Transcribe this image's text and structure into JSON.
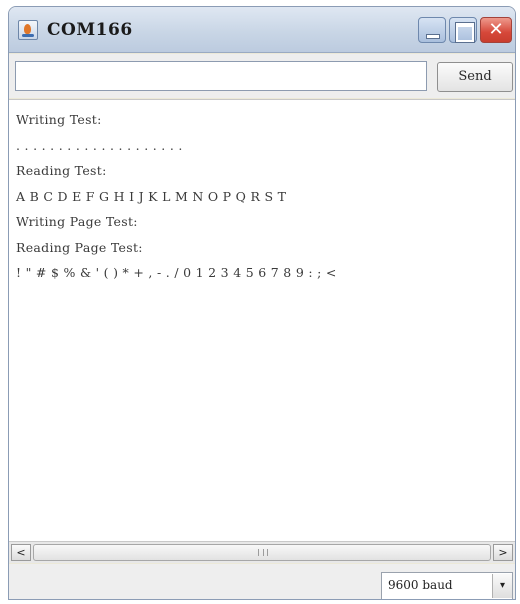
{
  "window": {
    "title": "COM166"
  },
  "toolbar": {
    "input_value": "",
    "send_label": "Send"
  },
  "output": {
    "lines": [
      "Writing Test:",
      ". . . . . . . . . . . . . . . . . . . .",
      "Reading Test:",
      "A B C D E F G H I J K L M N O P Q R S T",
      "Writing Page Test:",
      "Reading Page Test:",
      "! \" # $ % & ' ( ) * + , - . / 0 1 2 3 4 5 6 7 8 9 : ; <"
    ]
  },
  "scrollbar": {
    "left_arrow": "<",
    "right_arrow": ">"
  },
  "status": {
    "baud_selected": "9600 baud",
    "dropdown_arrow": "▾"
  },
  "icons": {
    "app": "java-coffee-icon",
    "minimize": "minimize-icon",
    "maximize": "maximize-icon",
    "close": "close-icon"
  },
  "colors": {
    "titlebar": "#c9d6e6",
    "close_button": "#d6483a",
    "output_background": "#ffffff"
  }
}
